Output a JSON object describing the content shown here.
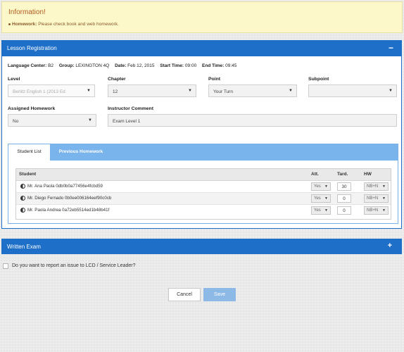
{
  "alert": {
    "title": "Information!",
    "item_label": "Homework:",
    "item_text": " Please check book and web homework."
  },
  "lesson_panel": {
    "title": "Lesson Registration",
    "collapse_symbol": "−",
    "meta": {
      "language_center_label": "Language Center:",
      "language_center_value": "B2",
      "group_label": "Group:",
      "group_value": "LEXINGTON 4Q",
      "date_label": "Date:",
      "date_value": "Feb 12, 2015",
      "start_label": "Start Time:",
      "start_value": "09:00",
      "end_label": "End Time:",
      "end_value": "09:45"
    },
    "fields": {
      "level_label": "Level",
      "level_value": "Berlitz English 1 (2013 Ed",
      "chapter_label": "Chapter",
      "chapter_value": "12",
      "point_label": "Point",
      "point_value": "Your Turn",
      "subpoint_label": "Subpoint",
      "subpoint_value": "",
      "homework_label": "Assigned Homework",
      "homework_value": "No",
      "comment_label": "Instructor Comment",
      "comment_value": "Exam Level 1"
    },
    "tabs": [
      "Student List",
      "Previous Homework"
    ],
    "grid": {
      "headers": {
        "student": "Student",
        "att": "Att.",
        "tard": "Tard.",
        "hw": "HW"
      },
      "rows": [
        {
          "name": "Mr. Ana Paola 0db0b0a77456e4fcbd59",
          "att": "Yes",
          "tard": "30",
          "hw": "NB+N"
        },
        {
          "name": "Mr. Diego Fernado 0b0ee006164eef90c0cb",
          "att": "Yes",
          "tard": "0",
          "hw": "NB+N"
        },
        {
          "name": "Mr. Paola Andrea 0a72eb5514ed1b48b41f",
          "att": "Yes",
          "tard": "0",
          "hw": "NB+N"
        }
      ]
    }
  },
  "written_exam": {
    "title": "Written Exam",
    "expand_symbol": "+"
  },
  "report_question": "Do you want to report an issue to LCD / Service Leader?",
  "buttons": {
    "cancel": "Cancel",
    "save": "Save"
  },
  "icons": {
    "caret": "▼"
  },
  "colors": {
    "panel_blue": "#1e6fc8",
    "tab_blue": "#7ab4ec",
    "alert_bg": "#fcf8c9",
    "save_btn": "#8db9e6"
  }
}
